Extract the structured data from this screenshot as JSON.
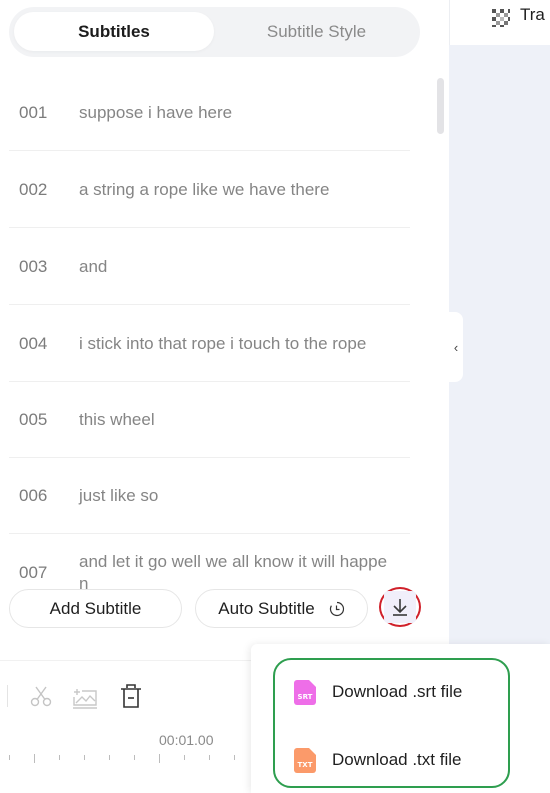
{
  "tabs": [
    {
      "label": "Subtitles",
      "active": true
    },
    {
      "label": "Subtitle Style",
      "active": false
    }
  ],
  "subtitles": [
    {
      "index": "001",
      "text": "suppose i have here"
    },
    {
      "index": "002",
      "text": "a string a rope like we have there"
    },
    {
      "index": "003",
      "text": "and"
    },
    {
      "index": "004",
      "text": "i stick into that rope i touch to the rope"
    },
    {
      "index": "005",
      "text": "this wheel"
    },
    {
      "index": "006",
      "text": "just like so"
    },
    {
      "index": "007",
      "text": "and let it go well we all know it will happen"
    }
  ],
  "buttons": {
    "add_subtitle": "Add Subtitle",
    "auto_subtitle": "Auto Subtitle",
    "download_icon": "download-icon"
  },
  "right_header": {
    "label": "Tra",
    "icon": "checkerboard-icon"
  },
  "timeline": {
    "time_label": "00:01.00",
    "tools": [
      "scissors-icon",
      "image-add-icon",
      "trash-icon"
    ]
  },
  "download_menu": {
    "items": [
      {
        "label": "Download .srt file",
        "ext": "SRT",
        "color": "#ee6ee8"
      },
      {
        "label": "Download .txt file",
        "ext": "TXT",
        "color": "#fb9a6a"
      }
    ]
  },
  "colors": {
    "highlight_red": "#d0202a",
    "highlight_green": "#2e9e4f",
    "preview_bg": "#eef1f8"
  }
}
